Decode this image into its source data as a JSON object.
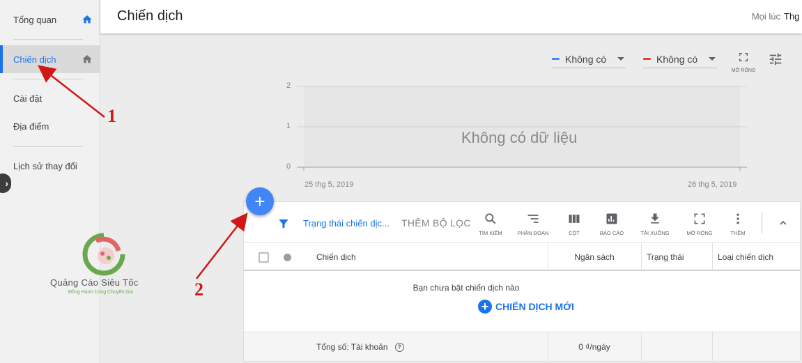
{
  "sidebar": {
    "items": [
      {
        "label": "Tổng quan"
      },
      {
        "label": "Chiến dịch"
      },
      {
        "label": "Cài đặt"
      },
      {
        "label": "Địa điểm"
      },
      {
        "label": "Lịch sử thay đổi"
      }
    ]
  },
  "logo": {
    "title": "Quảng Cáo Siêu Tốc",
    "subtitle": "Đồng Hành Cùng Chuyên Gia"
  },
  "header": {
    "title": "Chiến dịch",
    "time_label": "Mọi lúc",
    "time_value": "Thg"
  },
  "chart_controls": {
    "metric1": {
      "label": "Không có",
      "color": "#4285f4"
    },
    "metric2": {
      "label": "Không có",
      "color": "#db4437"
    },
    "expand_label": "MỞ RỘNG"
  },
  "chart_data": {
    "type": "line",
    "no_data_text": "Không có dữ liệu",
    "y_ticks": [
      "2",
      "1",
      "0"
    ],
    "ylim": [
      0,
      2
    ],
    "x_labels": [
      "25 thg 5, 2019",
      "26 thg 5, 2019"
    ],
    "series": []
  },
  "toolbar": {
    "filter_chip": "Trạng thái chiến dịc...",
    "add_filter": "THÊM BỘ LỌC",
    "tools": [
      {
        "label": "TÌM KIẾM",
        "icon": "search-icon"
      },
      {
        "label": "PHÂN ĐOẠN",
        "icon": "segment-icon"
      },
      {
        "label": "CỘT",
        "icon": "columns-icon"
      },
      {
        "label": "BÁO CÁO",
        "icon": "report-icon"
      },
      {
        "label": "TẢI XUỐNG",
        "icon": "download-icon"
      },
      {
        "label": "MỞ RỘNG",
        "icon": "expand-icon"
      },
      {
        "label": "THÊM",
        "icon": "more-icon"
      }
    ]
  },
  "table": {
    "columns": [
      "Chiến dịch",
      "Ngân sách",
      "Trạng thái",
      "Loại chiến dịch"
    ],
    "empty_message": "Bạn chưa bật chiến dịch nào",
    "new_campaign_label": "CHIẾN DỊCH MỚI",
    "total_label": "Tổng số: Tài khoản",
    "total_budget": "0 ₫/ngày"
  },
  "annotations": {
    "label1": "1",
    "label2": "2",
    "color": "#d01616"
  }
}
